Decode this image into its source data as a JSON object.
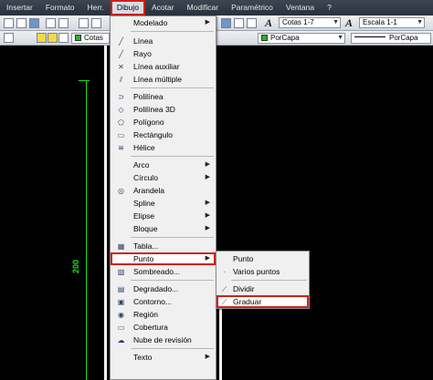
{
  "menubar": {
    "items": [
      "Insertar",
      "Formato",
      "Herr.",
      "Dibujo",
      "Acotar",
      "Modificar",
      "Paramétrico",
      "Ventana",
      "?"
    ],
    "active": "Dibujo"
  },
  "toolbar": {
    "dimstyle_combo": "Cotas 1-7",
    "scale_combo": "Escala 1-1",
    "layer_combo": "Cotas",
    "color_combo": "PorCapa",
    "linetype_combo": "PorCapa"
  },
  "drawing": {
    "dimension_label": "200",
    "line_color": "#19e019"
  },
  "dibujo_menu": {
    "items": {
      "modelado": "Modelado",
      "linea": "Línea",
      "rayo": "Rayo",
      "linea_auxiliar": "Línea auxiliar",
      "linea_multiple": "Línea múltiple",
      "polilinea": "Polilínea",
      "polilinea_3d": "Polilínea 3D",
      "poligono": "Polígono",
      "rectangulo": "Rectángulo",
      "helice": "Hélice",
      "arco": "Arco",
      "circulo": "Círculo",
      "arandela": "Arandela",
      "spline": "Spline",
      "elipse": "Elipse",
      "bloque": "Bloque",
      "tabla": "Tabla...",
      "punto": "Punto",
      "sombreado": "Sombreado...",
      "degradado": "Degradado...",
      "contorno": "Contorno...",
      "region": "Región",
      "cobertura": "Cobertura",
      "nube_revision": "Nube de revisión",
      "texto": "Texto"
    },
    "highlighted": "Punto"
  },
  "punto_submenu": {
    "items": {
      "punto": "Punto",
      "varios_puntos": "Varios puntos",
      "dividir": "Dividir",
      "graduar": "Graduar"
    },
    "highlighted": "Graduar"
  },
  "colors": {
    "highlight_outline": "#d0201a",
    "menubar_bg": "#2f3641"
  }
}
